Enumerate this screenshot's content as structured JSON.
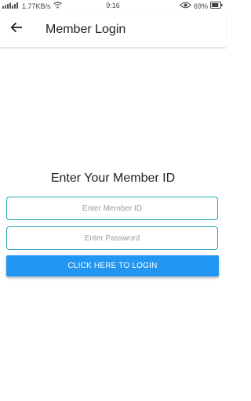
{
  "status_bar": {
    "net_speed": "1.77KB/s",
    "time": "9:16",
    "battery_percent": "69%",
    "battery_level": 0.69,
    "icons": [
      "signal-icon",
      "wifi-icon",
      "eye-icon",
      "battery-icon"
    ]
  },
  "app_bar": {
    "title": "Member Login",
    "back_icon": "arrow-left-icon"
  },
  "login": {
    "prompt": "Enter Your Member ID",
    "member_id_placeholder": "Enter Member ID",
    "member_id_value": "",
    "password_placeholder": "Enter Password",
    "password_value": "",
    "button_label": "CLICK HERE TO LOGIN"
  },
  "colors": {
    "accent": "#2196f3",
    "field_border": "#26a6b6",
    "background": "#ffffff",
    "text": "#212121",
    "placeholder": "#9e9e9e"
  }
}
